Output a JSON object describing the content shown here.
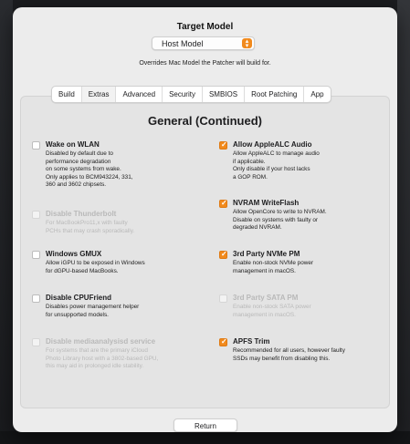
{
  "header": {
    "title": "Target Model",
    "model_selected": "Host Model",
    "subtitle": "Overrides Mac Model the Patcher will build for."
  },
  "tabs": [
    {
      "label": "Build"
    },
    {
      "label": "Extras"
    },
    {
      "label": "Advanced"
    },
    {
      "label": "Security"
    },
    {
      "label": "SMBIOS"
    },
    {
      "label": "Root Patching"
    },
    {
      "label": "App"
    }
  ],
  "active_tab": "Extras",
  "section_title": "General (Continued)",
  "left_options": [
    {
      "label": "Wake on WLAN",
      "checked": false,
      "enabled": true,
      "desc": [
        "Disabled by default due to",
        "performance degradation",
        "on some systems from wake.",
        "Only applies to BCM943224, 331,",
        "360 and 3602 chipsets."
      ]
    },
    {
      "label": "Disable Thunderbolt",
      "checked": false,
      "enabled": false,
      "desc": [
        "For MacBookPro11,x with faulty",
        "PCHs that may crash sporadically."
      ]
    },
    {
      "label": "Windows GMUX",
      "checked": false,
      "enabled": true,
      "desc": [
        "Allow iGPU to be exposed in Windows",
        "for dGPU-based MacBooks."
      ]
    },
    {
      "label": "Disable CPUFriend",
      "checked": false,
      "enabled": true,
      "desc": [
        "Disables power management helper",
        "for unsupported models."
      ]
    },
    {
      "label": "Disable mediaanalysisd service",
      "checked": false,
      "enabled": false,
      "desc": [
        "For systems that are the primary iCloud",
        "Photo Library host with a 3802-based GPU,",
        "this may aid in prolonged idle stability."
      ]
    }
  ],
  "right_options": [
    {
      "label": "Allow AppleALC Audio",
      "checked": true,
      "enabled": true,
      "desc": [
        "Allow AppleALC to manage audio",
        "if applicable.",
        "Only disable if your host lacks",
        "a GOP ROM."
      ]
    },
    {
      "label": "NVRAM WriteFlash",
      "checked": true,
      "enabled": true,
      "desc": [
        "Allow OpenCore to write to NVRAM.",
        "Disable on systems with faulty or",
        "degraded NVRAM."
      ]
    },
    {
      "label": "3rd Party NVMe PM",
      "checked": true,
      "enabled": true,
      "desc": [
        "Enable non-stock NVMe power",
        "management in macOS."
      ]
    },
    {
      "label": "3rd Party SATA PM",
      "checked": false,
      "enabled": false,
      "desc": [
        "Enable non-stock SATA power",
        "management in macOS."
      ]
    },
    {
      "label": "APFS Trim",
      "checked": true,
      "enabled": true,
      "desc": [
        "Recommended for all users, however faulty",
        "SSDs may benefit from disabling this."
      ]
    }
  ],
  "return_label": "Return",
  "colors": {
    "accent": "#f18a1d",
    "window_bg": "#ececec",
    "disabled_text": "#b9b9b9"
  }
}
